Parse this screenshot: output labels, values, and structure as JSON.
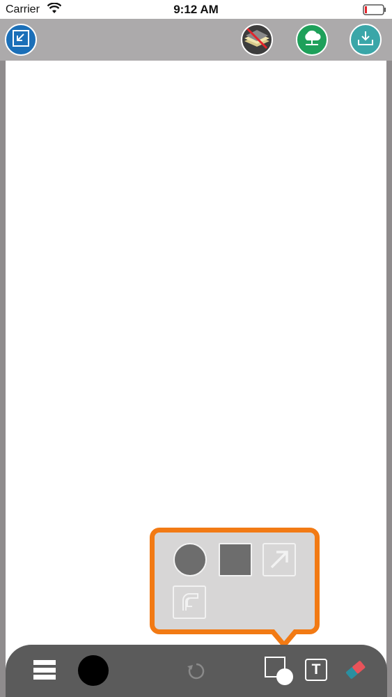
{
  "status_bar": {
    "carrier": "Carrier",
    "time": "9:12 AM"
  },
  "top_bar": {
    "buttons": [
      {
        "icon": "import-icon",
        "color": "#1b6fb8"
      },
      {
        "icon": "layers-hidden-icon",
        "color": "#3d3d3d"
      },
      {
        "icon": "cloud-network-icon",
        "color": "#1ea05a"
      },
      {
        "icon": "download-icon",
        "color": "#3aa6a8"
      }
    ]
  },
  "shape_popup": {
    "accent_color": "#f27a14",
    "options": [
      "circle-shape-icon",
      "square-shape-icon",
      "arrow-shape-icon",
      "freeform-shape-icon"
    ]
  },
  "toolbar": {
    "current_color": "#000000",
    "text_tool_label": "T",
    "tools": [
      "menu-icon",
      "color-swatch",
      "undo-icon",
      "shape-tool-icon",
      "text-tool-icon",
      "eraser-icon"
    ]
  }
}
